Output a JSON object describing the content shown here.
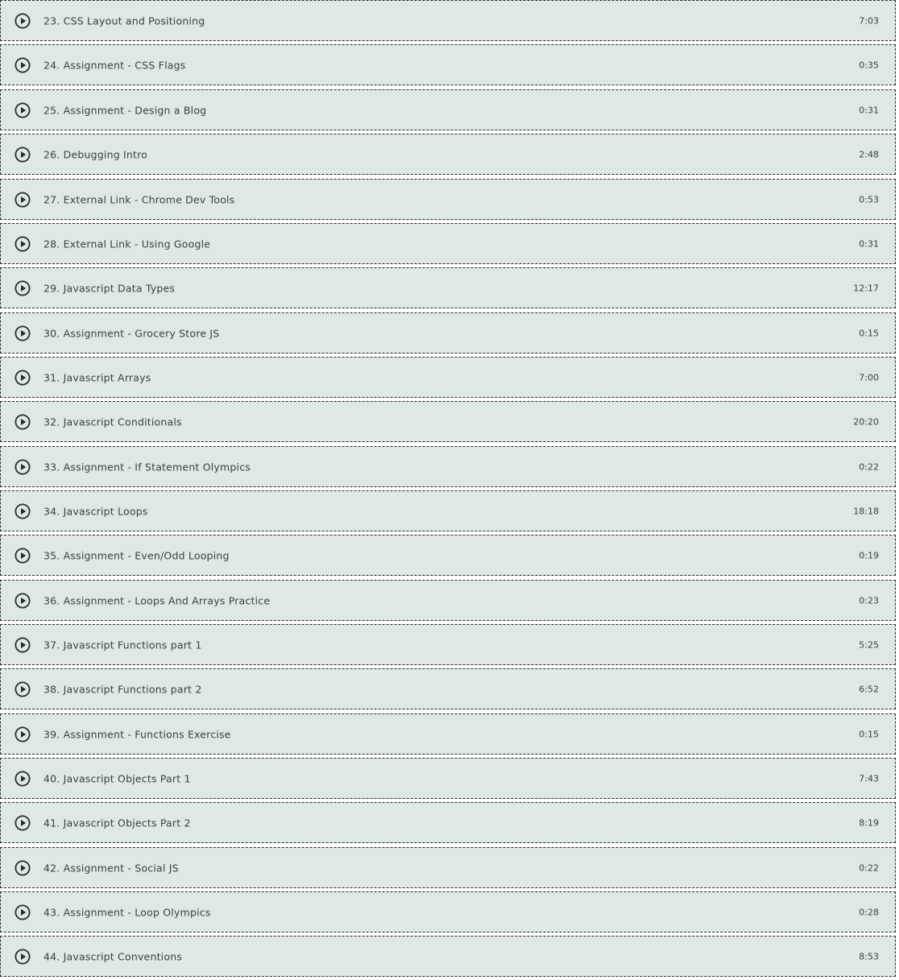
{
  "lectures": [
    {
      "title": "23. CSS Layout and Positioning",
      "duration": "7:03"
    },
    {
      "title": "24. Assignment - CSS Flags",
      "duration": "0:35"
    },
    {
      "title": "25. Assignment - Design a Blog",
      "duration": "0:31"
    },
    {
      "title": "26. Debugging Intro",
      "duration": "2:48"
    },
    {
      "title": "27. External Link - Chrome Dev Tools",
      "duration": "0:53"
    },
    {
      "title": "28. External Link - Using Google",
      "duration": "0:31"
    },
    {
      "title": "29. Javascript Data Types",
      "duration": "12:17"
    },
    {
      "title": "30. Assignment - Grocery Store JS",
      "duration": "0:15"
    },
    {
      "title": "31. Javascript Arrays",
      "duration": "7:00"
    },
    {
      "title": "32. Javascript Conditionals",
      "duration": "20:20"
    },
    {
      "title": "33. Assignment - If Statement Olympics",
      "duration": "0:22"
    },
    {
      "title": "34. Javascript Loops",
      "duration": "18:18"
    },
    {
      "title": "35. Assignment - Even/Odd Looping",
      "duration": "0:19"
    },
    {
      "title": "36. Assignment - Loops And Arrays Practice",
      "duration": "0:23"
    },
    {
      "title": "37. Javascript Functions part 1",
      "duration": "5:25"
    },
    {
      "title": "38. Javascript Functions part 2",
      "duration": "6:52"
    },
    {
      "title": "39. Assignment - Functions Exercise",
      "duration": "0:15"
    },
    {
      "title": "40. Javascript Objects Part 1",
      "duration": "7:43"
    },
    {
      "title": "41. Javascript Objects Part 2",
      "duration": "8:19"
    },
    {
      "title": "42. Assignment - Social JS",
      "duration": "0:22"
    },
    {
      "title": "43. Assignment - Loop Olympics",
      "duration": "0:28"
    },
    {
      "title": "44. Javascript Conventions",
      "duration": "8:53"
    }
  ],
  "icons": {
    "play": "play-circle-icon"
  },
  "colors": {
    "row_background": "#dde9e2",
    "text": "#3b3f44",
    "border": "#2c2c2c"
  }
}
